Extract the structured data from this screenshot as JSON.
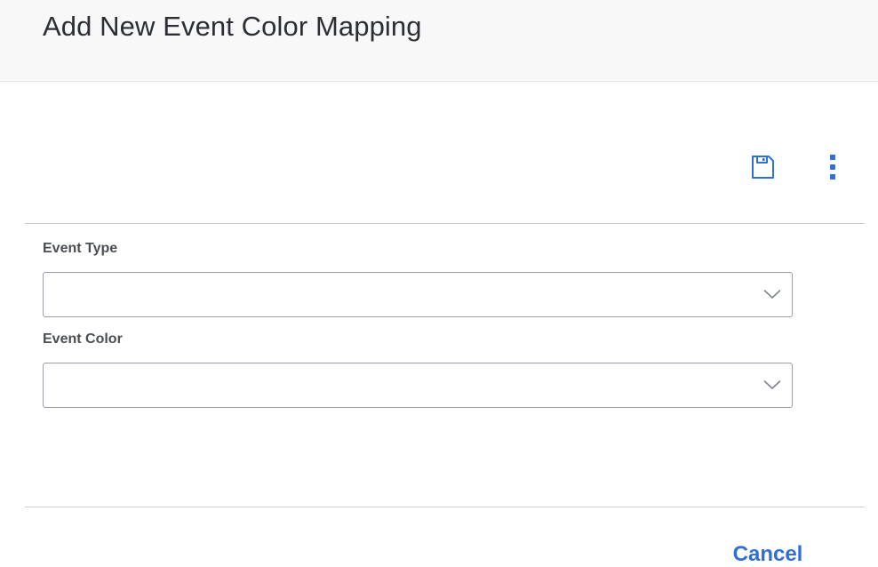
{
  "dialog": {
    "title": "Add New Event Color Mapping"
  },
  "toolbar": {
    "save_icon": "save-icon",
    "more_icon": "more-vertical-icon",
    "accent_color": "#2f6fd6"
  },
  "form": {
    "fields": [
      {
        "label": "Event Type",
        "value": "",
        "icon": "chevron-down-icon"
      },
      {
        "label": "Event Color",
        "value": "",
        "icon": "chevron-down-icon"
      }
    ]
  },
  "footer": {
    "cancel_label": "Cancel"
  }
}
